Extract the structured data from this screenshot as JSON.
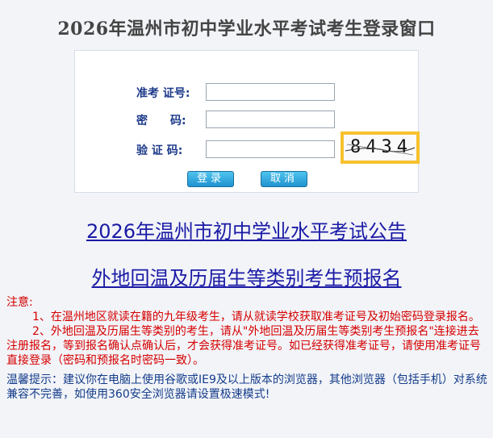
{
  "page": {
    "title": "2026年温州市初中学业水平考试考生登录窗口"
  },
  "form": {
    "fields": [
      {
        "label": "准考 证号:",
        "value": "",
        "placeholder": ""
      },
      {
        "label": "密　　码:",
        "value": "",
        "placeholder": ""
      },
      {
        "label": "验 证 码:",
        "value": "",
        "placeholder": ""
      }
    ],
    "captcha_text": "8434",
    "login_label": "登录",
    "cancel_label": "取消"
  },
  "links": {
    "announcement": "2026年温州市初中学业水平考试公告",
    "preregister": "外地回温及历届生等类别考生预报名"
  },
  "notice": {
    "heading": "注意:",
    "item1": "1、在温州地区就读在籍的九年级考生，请从就读学校获取准考证号及初始密码登录报名。",
    "item2": "2、外地回温及历届生等类别的考生，请从\"外地回温及历届生等类别考生预报名\"连接进去注册报名，等到报名确认点确认后，才会获得准考证号。如已经获得准考证号，请使用准考证号直接登录（密码和预报名时密码一致）。",
    "tip": "温馨提示：建议你在电脑上使用谷歌或IE9及以上版本的浏览器，其他浏览器（包括手机）对系统兼容不完善，如使用360安全浏览器请设置极速模式!"
  },
  "colors": {
    "title": "#444444",
    "label": "#1d3a8a",
    "link": "#1a1aa6",
    "notice_red": "#d60000",
    "tip_blue": "#143c8a",
    "captcha_border": "#f6c22e",
    "button": "#1f93cf"
  }
}
